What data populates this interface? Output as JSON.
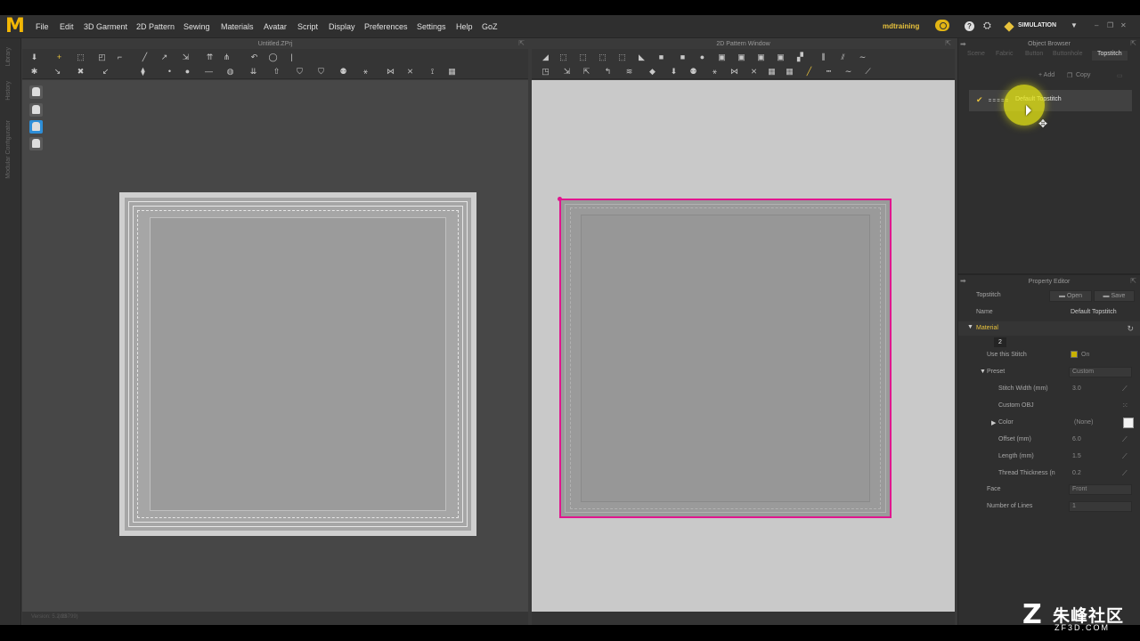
{
  "app": {
    "logo_text": "M"
  },
  "menu": [
    "File",
    "Edit",
    "3D Garment",
    "2D Pattern",
    "Sewing",
    "Materials",
    "Avatar",
    "Script",
    "Display",
    "Preferences",
    "Settings",
    "Help",
    "GoZ"
  ],
  "header_right": {
    "user": "mdtraining",
    "mode": "SIMULATION",
    "help_label": "?"
  },
  "left_strip": {
    "labels": [
      "Library",
      "History",
      "Modular Configurator"
    ]
  },
  "window_3d": {
    "title": "Untitled.ZPrj"
  },
  "window_2d": {
    "title": "2D Pattern Window"
  },
  "status_3d": [
    "Version: 5.2.83",
    "(r26799)"
  ],
  "object_browser": {
    "title": "Object Browser",
    "tabs": [
      "Scene",
      "Fabric",
      "Button",
      "Buttonhole",
      "Topstitch"
    ],
    "active_tab": "Topstitch",
    "add_label": "+ Add",
    "copy_label": "Copy",
    "item_name": "Default Topstitch"
  },
  "property_editor": {
    "title": "Property Editor",
    "type_label": "Topstitch",
    "open_label": "Open",
    "save_label": "Save",
    "name_label": "Name",
    "name_value": "Default Topstitch",
    "section": "Material",
    "tab_num": "2",
    "use_stitch_label": "Use this Stitch",
    "use_stitch_value": "On",
    "preset_label": "Preset",
    "preset_value": "Custom",
    "stitch_width_label": "Stitch Width (mm)",
    "stitch_width_value": "3.0",
    "custom_obj_label": "Custom OBJ",
    "color_label": "Color",
    "color_value": "(None)",
    "offset_label": "Offset (mm)",
    "offset_value": "6.0",
    "length_label": "Length (mm)",
    "length_value": "1.5",
    "thread_label": "Thread Thickness (n",
    "thread_value": "0.2",
    "face_label": "Face",
    "face_value": "Front",
    "lines_label": "Number of Lines",
    "lines_value": "1",
    "accent_color": "#e8c23c",
    "pattern_outline_color": "#e0168e"
  },
  "watermark": {
    "cn": "朱峰社区",
    "url": "ZF3D.COM"
  }
}
